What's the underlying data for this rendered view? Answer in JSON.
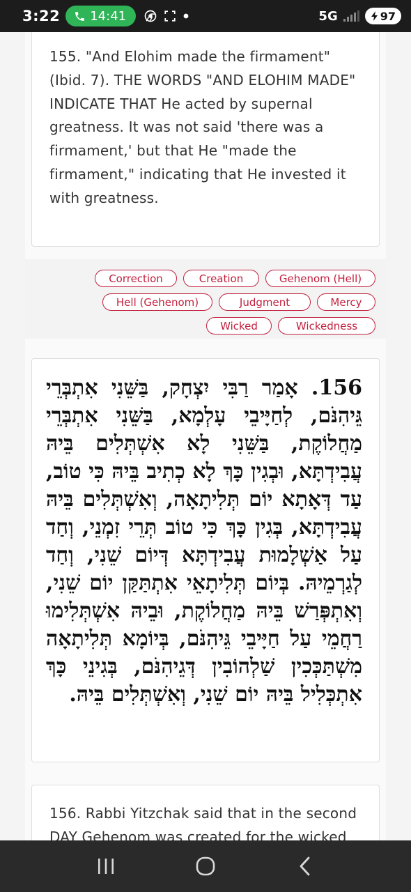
{
  "status_bar": {
    "time": "3:22",
    "call_timer": "14:41",
    "network": "5G",
    "battery": "97"
  },
  "passage_155": {
    "english": "155. \"And Elohim made the firmament\" (Ibid. 7). THE WORDS \"AND ELOHIM MADE\" INDICATE THAT He acted by supernal greatness. It was not said 'there was a firmament,' but that He \"made the firmament,\" indicating that He invested it with greatness."
  },
  "tags": {
    "row1": [
      "Correction",
      "Creation",
      "Gehenom (Hell)"
    ],
    "row2": [
      "Hell (Gehenom)",
      "Judgment",
      "Mercy"
    ],
    "row3": [
      "Wicked",
      "Wickedness"
    ]
  },
  "passage_156": {
    "hebrew": "156. אָמַר רַבִּי יִצְחָק, בַּשֵּׁנִי אִתְבְּרֵי גֵּיהִנֹּם, לְחַיָּיבֵי עָלְמָא, בַּשֵּׁנִי אִתְבְּרֵי מַחֲלוֹקֶת, בַּשֵּׁנִי לָא אִשְׁתְּלִים בֵּיהּ עֲבִידְתָּא, וּבְגִין כָּךְ לָא כְתִיב בֵּיהּ כִּי טוֹב, עַד דְּאָתָא יוֹם תְּלִיתָאָה, וְאִשְׁתְּלִים בֵּיהּ עֲבִידְתָּא, בְּגִין כָּךְ כִּי טוֹב תְּרֵי זִמְנֵי, וְחַד עַל אַשְׁלָמוּת עֲבִידְתָּא דְּיוֹם שֵׁנִי, וְחַד לְגַרְמֵיהּ. בְּיוֹם תְּלִיתָאֵי אִתְתַּקַּן יוֹם שֵׁנִי, וְאִתְפְּרַשׁ בֵּיהּ מַחֲלוֹקֶת, וּבֵיהּ אִשְׁתְּלִימוּ רַחֲמֵי עַל חַיָּיבֵי גֵּיהִנֹּם, בְּיוֹמָא תְּלִיתָאָה מִשְׁתַּכְּכִין שַׁלְהוֹבִין דְּגֵיהִנֹּם, בְּגִינֵי כָּךְ אִתְכְּלִיל בֵּיהּ יוֹם שֵׁנִי, וְאִשְׁתְּלִים בֵּיהּ."
  },
  "passage_156_en": {
    "english": "156. Rabbi Yitzchak said that in the second DAY Gehenom was created for the wicked"
  },
  "icons": {
    "call": "phone-icon",
    "chrome": "chrome-icon",
    "screenshot": "screenshot-icon",
    "recents": "recents-icon",
    "home": "home-icon",
    "back": "back-icon"
  },
  "colors": {
    "accent": "#c2203e",
    "call_pill": "#2fb457"
  }
}
